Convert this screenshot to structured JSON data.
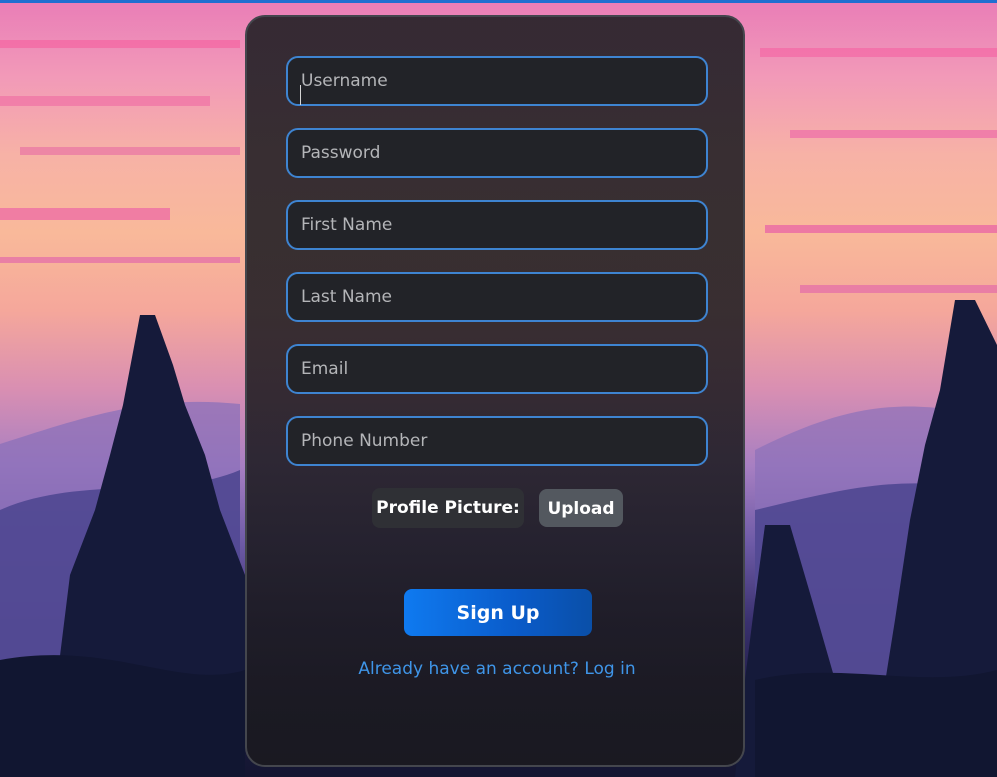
{
  "form": {
    "fields": [
      {
        "placeholder": "Username",
        "value": ""
      },
      {
        "placeholder": "Password",
        "value": ""
      },
      {
        "placeholder": "First Name",
        "value": ""
      },
      {
        "placeholder": "Last Name",
        "value": ""
      },
      {
        "placeholder": "Email",
        "value": ""
      },
      {
        "placeholder": "Phone Number",
        "value": ""
      }
    ],
    "profile_picture_label": "Profile Picture:",
    "upload_label": "Upload",
    "signup_label": "Sign Up",
    "login_link": "Already have an account? Log in"
  },
  "colors": {
    "accent": "#3e84d1",
    "button": "#0f7af0",
    "link": "#3f95e8"
  }
}
